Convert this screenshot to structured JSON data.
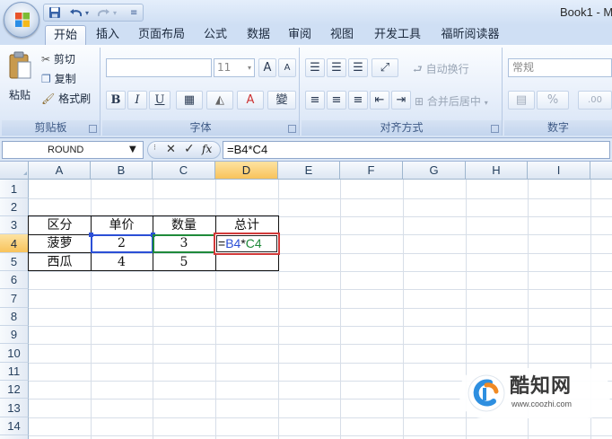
{
  "window": {
    "title": "Book1 - M"
  },
  "quick_access": {
    "save_icon": "save-icon",
    "undo_icon": "undo-icon",
    "redo_icon": "redo-icon"
  },
  "tabs": [
    {
      "label": "开始",
      "active": true
    },
    {
      "label": "插入"
    },
    {
      "label": "页面布局"
    },
    {
      "label": "公式"
    },
    {
      "label": "数据"
    },
    {
      "label": "审阅"
    },
    {
      "label": "视图"
    },
    {
      "label": "开发工具"
    },
    {
      "label": "福昕阅读器"
    }
  ],
  "ribbon": {
    "clipboard": {
      "label": "剪贴板",
      "paste": "粘贴",
      "cut": "剪切",
      "copy": "复制",
      "format_painter": "格式刷"
    },
    "font": {
      "label": "字体",
      "font_name": "",
      "font_size": "11",
      "bold": "B",
      "italic": "I",
      "underline": "U",
      "grow_font": "A",
      "shrink_font": "A",
      "phonetic": "變"
    },
    "alignment": {
      "label": "对齐方式",
      "wrap_text": "自动换行",
      "merge_center": "合并后居中"
    },
    "number": {
      "label": "数字",
      "format": "常规",
      "percent": "%"
    }
  },
  "formula_bar": {
    "name_box": "ROUND",
    "cancel": "✕",
    "enter": "✓",
    "fx": "fx",
    "formula": "=B4*C4"
  },
  "sheet": {
    "columns": [
      "A",
      "B",
      "C",
      "D",
      "E",
      "F",
      "G",
      "H",
      "I"
    ],
    "rows": [
      "1",
      "2",
      "3",
      "4",
      "5",
      "6",
      "7",
      "8",
      "9",
      "10",
      "11",
      "12",
      "13",
      "14"
    ],
    "selected_column": "D",
    "selected_row": "4",
    "header_row": [
      "区分",
      "单价",
      "数量",
      "总计"
    ],
    "row4": [
      "菠萝",
      "2",
      "3"
    ],
    "row5": [
      "西瓜",
      "4",
      "5"
    ],
    "editing_cell": {
      "eq": "=",
      "ref1": "B4",
      "op": "*",
      "ref2": "C4",
      "ref1_color": "#2b4fd6",
      "ref2_color": "#1f8a3a",
      "highlight_color": "#d23a3a"
    }
  },
  "watermark": {
    "name": "酷知网",
    "url": "www.coozhi.com"
  },
  "colors": {
    "accent": "#9db3d6",
    "selected_header": "#f8c35b"
  }
}
